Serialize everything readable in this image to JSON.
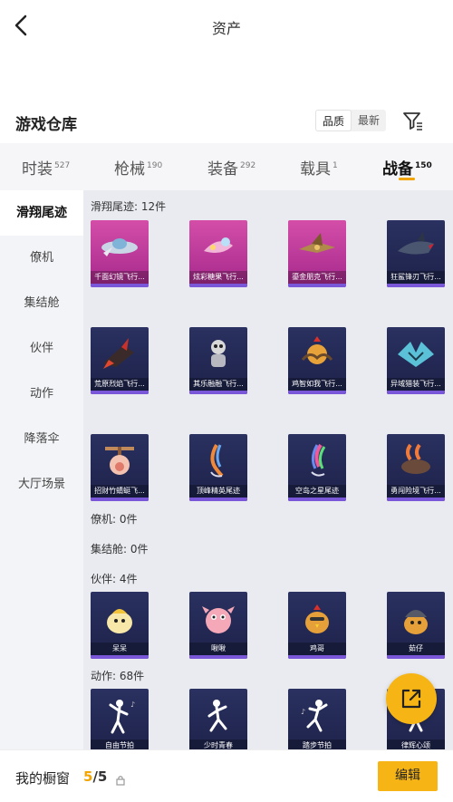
{
  "header": {
    "title": "资产"
  },
  "section": {
    "title": "游戏仓库",
    "sort_options": [
      "品质",
      "最新"
    ]
  },
  "tabs": [
    {
      "label": "时装",
      "count": "527"
    },
    {
      "label": "枪械",
      "count": "190"
    },
    {
      "label": "装备",
      "count": "292"
    },
    {
      "label": "载具",
      "count": "1"
    },
    {
      "label": "战备",
      "count": "150"
    }
  ],
  "sidebar": [
    "滑翔尾迹",
    "僚机",
    "集结舱",
    "伙伴",
    "动作",
    "降落伞",
    "大厅场景"
  ],
  "groups": {
    "glide_trail": {
      "label": "滑翔尾迹: 12件",
      "items": [
        "千面幻镜飞行...",
        "炫彩糖果飞行...",
        "鎏金朋克飞行...",
        "狂鲨锋刃飞行...",
        "荒原烈焰飞行...",
        "其乐融融飞行...",
        "鸡智如我飞行...",
        "异域猎装飞行...",
        "招财竹蜻蜓飞...",
        "顶峰精英尾迹",
        "空岛之星尾迹",
        "勇闯险境飞行..."
      ]
    },
    "wingman": {
      "label": "僚机: 0件"
    },
    "capsule": {
      "label": "集结舱: 0件"
    },
    "companion": {
      "label": "伙伴: 4件",
      "items": [
        "呆呆",
        "啾啾",
        "鸡哥",
        "茹仔"
      ]
    },
    "emote": {
      "label": "动作: 68件",
      "items": [
        "自由节拍",
        "少时青春",
        "踏步节拍",
        "律辉心颂"
      ]
    }
  },
  "bottom": {
    "showcase_label": "我的橱窗",
    "current": "5",
    "total": "/5",
    "edit_label": "编辑"
  },
  "colors": {
    "accent": "#f7b515",
    "purple_bar": "#7a56d8"
  }
}
